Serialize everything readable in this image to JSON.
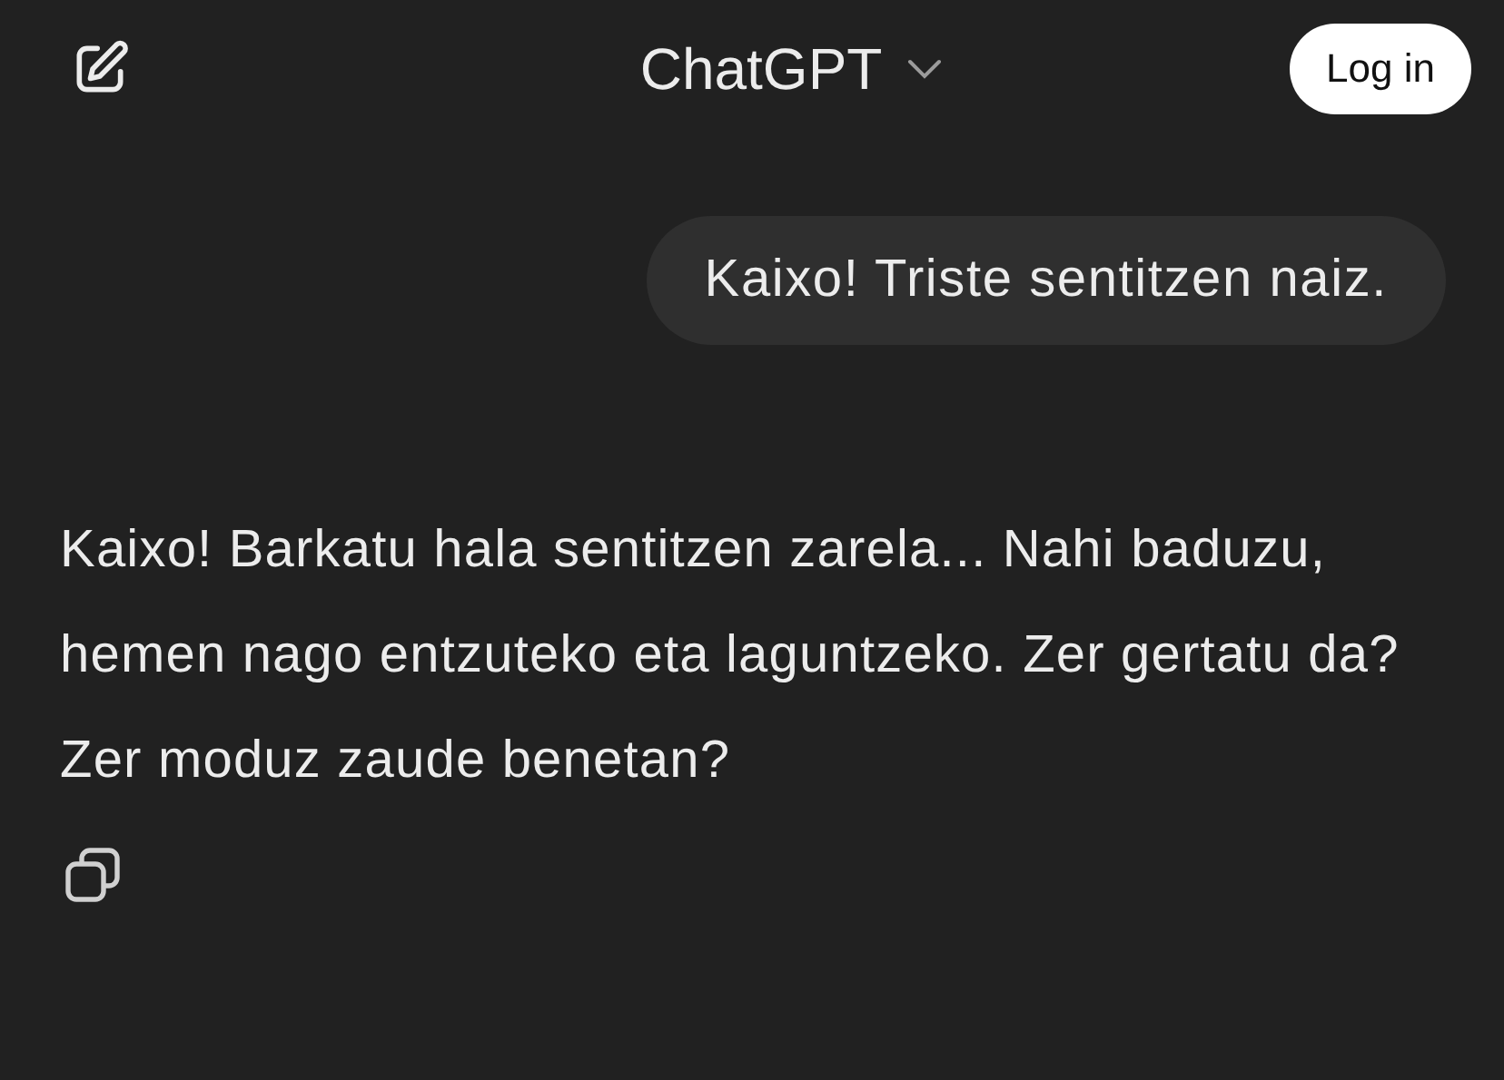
{
  "header": {
    "title": "ChatGPT",
    "login": "Log in"
  },
  "messages": [
    {
      "kind": "user",
      "text": "Kaixo! Triste sentitzen naiz."
    },
    {
      "kind": "assistant",
      "text": "Kaixo! Barkatu hala sentitzen zarela... Nahi baduzu, hemen nago entzuteko eta laguntzeko. Zer gertatu da? Zer moduz zaude benetan?"
    }
  ]
}
